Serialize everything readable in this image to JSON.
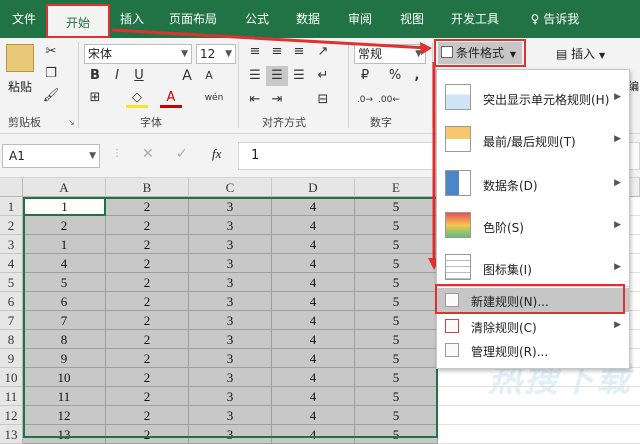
{
  "tabs": [
    "文件",
    "开始",
    "插入",
    "页面布局",
    "公式",
    "数据",
    "审阅",
    "视图",
    "开发工具"
  ],
  "tell_me": "告诉我",
  "clipboard": {
    "paste": "粘贴",
    "group": "剪贴板"
  },
  "font": {
    "name": "宋体",
    "size": "12",
    "group": "字体",
    "bold": "B",
    "italic": "I",
    "underline": "U",
    "grow": "A",
    "shrink": "A",
    "font_color": "A",
    "wen": "wén"
  },
  "alignment": {
    "group": "对齐方式"
  },
  "number": {
    "format": "常规",
    "group": "数字",
    "percent": "%",
    "comma": ","
  },
  "cf_button": "条件格式",
  "insert_button": "插入",
  "edit_cut": "编",
  "formula_bar": {
    "cell_ref": "A1",
    "fx": "fx",
    "value": "1"
  },
  "columns": [
    "A",
    "B",
    "C",
    "D",
    "E"
  ],
  "rows": [
    [
      "1",
      "1",
      "2",
      "3",
      "4",
      "5"
    ],
    [
      "2",
      "2",
      "2",
      "3",
      "4",
      "5"
    ],
    [
      "3",
      "1",
      "2",
      "3",
      "4",
      "5"
    ],
    [
      "4",
      "4",
      "2",
      "3",
      "4",
      "5"
    ],
    [
      "5",
      "5",
      "2",
      "3",
      "4",
      "5"
    ],
    [
      "6",
      "6",
      "2",
      "3",
      "4",
      "5"
    ],
    [
      "7",
      "7",
      "2",
      "3",
      "4",
      "5"
    ],
    [
      "8",
      "8",
      "2",
      "3",
      "4",
      "5"
    ],
    [
      "9",
      "9",
      "2",
      "3",
      "4",
      "5"
    ],
    [
      "10",
      "10",
      "2",
      "3",
      "4",
      "5"
    ],
    [
      "11",
      "11",
      "2",
      "3",
      "4",
      "5"
    ],
    [
      "12",
      "12",
      "2",
      "3",
      "4",
      "5"
    ],
    [
      "13",
      "13",
      "2",
      "3",
      "4",
      "5"
    ]
  ],
  "menu": {
    "items": [
      {
        "label": "突出显示单元格规则(H)",
        "icon": "highlight-rules-icon"
      },
      {
        "label": "最前/最后规则(T)",
        "icon": "top-bottom-rules-icon"
      },
      {
        "label": "数据条(D)",
        "icon": "data-bars-icon"
      },
      {
        "label": "色阶(S)",
        "icon": "color-scales-icon"
      },
      {
        "label": "图标集(I)",
        "icon": "icon-sets-icon"
      }
    ],
    "new_rule": "新建规则(N)...",
    "clear_rules": "清除规则(C)",
    "manage_rules": "管理规则(R)..."
  },
  "watermark": "热搜下载",
  "colors": {
    "excel_green": "#217346",
    "annotation_red": "#e03030",
    "selection_gray": "#c8c8c8"
  }
}
